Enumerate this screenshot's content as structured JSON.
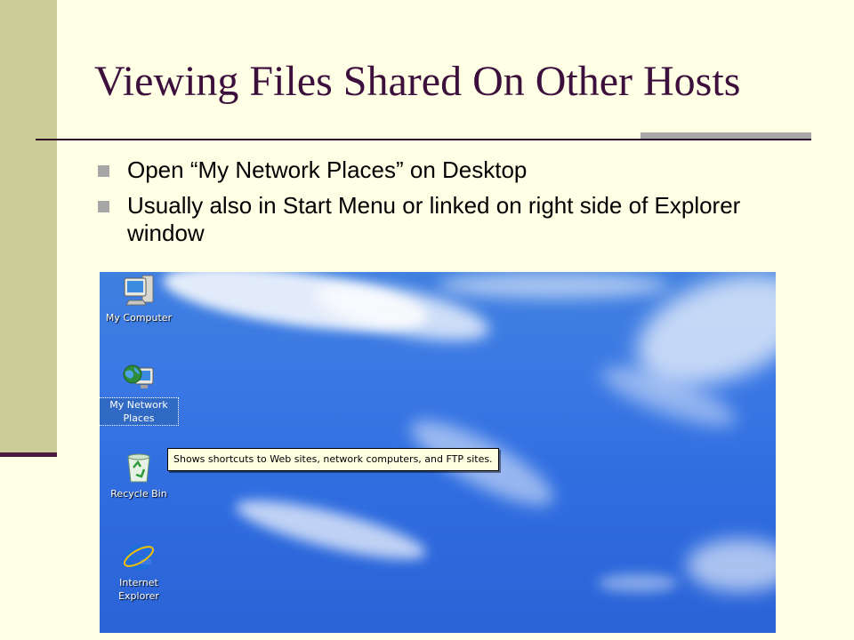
{
  "slide": {
    "title": "Viewing Files Shared On Other Hosts",
    "bullets": [
      "Open “My Network Places” on Desktop",
      "Usually also in Start Menu or linked on right side of Explorer window"
    ]
  },
  "desktop": {
    "icons": [
      {
        "name": "my-computer",
        "label": "My Computer",
        "icon": "computer-icon"
      },
      {
        "name": "my-network-places",
        "label": "My Network Places",
        "icon": "network-globe-icon",
        "selected": true
      },
      {
        "name": "recycle-bin",
        "label": "Recycle Bin",
        "icon": "recycle-bin-icon"
      },
      {
        "name": "internet-explorer",
        "label": "Internet Explorer",
        "icon": "internet-explorer-icon"
      }
    ],
    "tooltip": "Shows shortcuts to Web sites, network computers, and FTP sites."
  },
  "colors": {
    "background": "#FFFFE5",
    "title": "#3D0F3D",
    "side_band": "#CCCC99",
    "accent": "#4C1A40",
    "bullet_marker": "#A6A6A6",
    "desktop_sky": "#3A78E4",
    "selection": "#316AC5"
  }
}
